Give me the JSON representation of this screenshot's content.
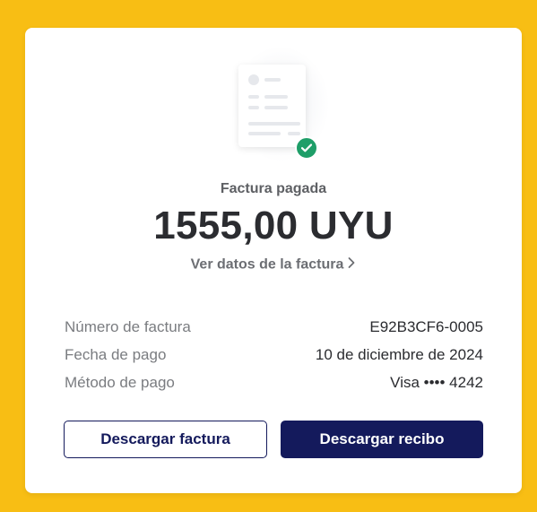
{
  "colors": {
    "page_background": "#F8BE14",
    "card_background": "#FFFFFF",
    "accent_navy": "#141A5C",
    "success_green": "#1E9E68"
  },
  "illustration": {
    "icon": "invoice-document-icon",
    "badge_icon": "check-circle-icon"
  },
  "invoice": {
    "status": "Factura pagada",
    "amount": "1555,00 UYU",
    "details_link": "Ver datos de la factura"
  },
  "info_rows": [
    {
      "label": "Número de factura",
      "value": "E92B3CF6-0005"
    },
    {
      "label": "Fecha de pago",
      "value": "10 de diciembre de 2024"
    },
    {
      "label": "Método de pago",
      "value": "Visa •••• 4242"
    }
  ],
  "actions": {
    "download_invoice": "Descargar factura",
    "download_receipt": "Descargar recibo"
  }
}
